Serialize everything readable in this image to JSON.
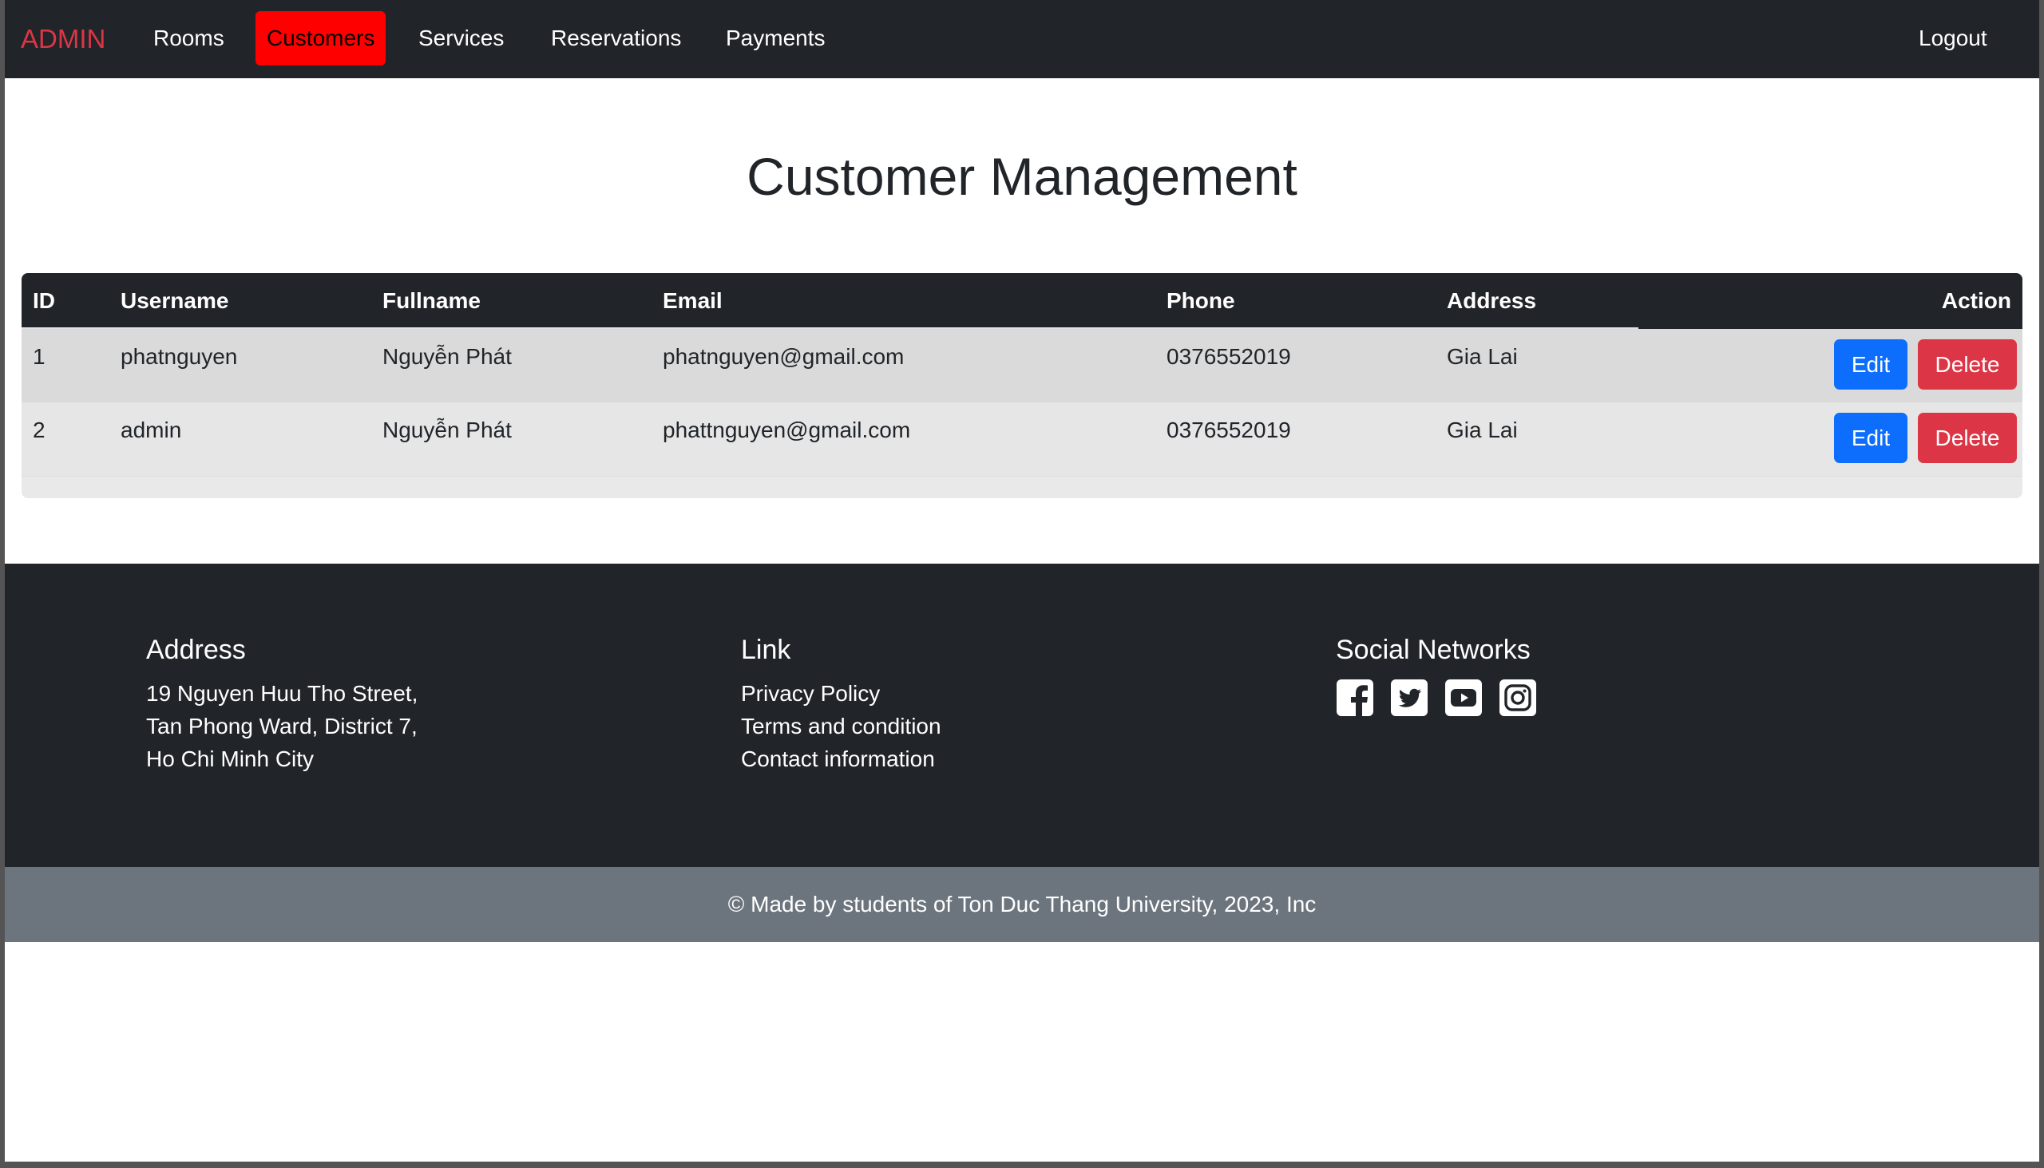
{
  "navbar": {
    "brand": "ADMIN",
    "links": [
      {
        "label": "Rooms",
        "active": false
      },
      {
        "label": "Customers",
        "active": true
      },
      {
        "label": "Services",
        "active": false
      },
      {
        "label": "Reservations",
        "active": false
      },
      {
        "label": "Payments",
        "active": false
      }
    ],
    "logout_label": "Logout",
    "colors": {
      "background": "#212529",
      "brand": "#dc3545",
      "active": "#ff0000"
    }
  },
  "page": {
    "title": "Customer Management"
  },
  "table": {
    "columns": [
      "ID",
      "Username",
      "Fullname",
      "Email",
      "Phone",
      "Address",
      "Action"
    ],
    "rows": [
      {
        "id": "1",
        "username": "phatnguyen",
        "fullname": "Nguyễn Phát",
        "email": "phatnguyen@gmail.com",
        "phone": "0376552019",
        "address": "Gia Lai",
        "edit_label": "Edit",
        "delete_label": "Delete"
      },
      {
        "id": "2",
        "username": "admin",
        "fullname": "Nguyễn Phát",
        "email": "phattnguyen@gmail.com",
        "phone": "0376552019",
        "address": "Gia Lai",
        "edit_label": "Edit",
        "delete_label": "Delete"
      }
    ],
    "colors": {
      "edit": "#0d6efd",
      "delete": "#dc3545",
      "header": "#212529"
    }
  },
  "footer": {
    "address": {
      "heading": "Address",
      "lines": [
        "19 Nguyen Huu Tho Street,",
        "Tan Phong Ward, District 7,",
        "Ho Chi Minh City"
      ]
    },
    "link": {
      "heading": "Link",
      "items": [
        "Privacy Policy",
        "Terms and condition",
        "Contact information"
      ]
    },
    "social": {
      "heading": "Social Networks",
      "icons": [
        "facebook-icon",
        "twitter-icon",
        "youtube-icon",
        "instagram-icon"
      ]
    },
    "copyright": "© Made by students of Ton Duc Thang University, 2023, Inc",
    "colors": {
      "background": "#212529",
      "bottom_bar": "#6c757d"
    }
  }
}
